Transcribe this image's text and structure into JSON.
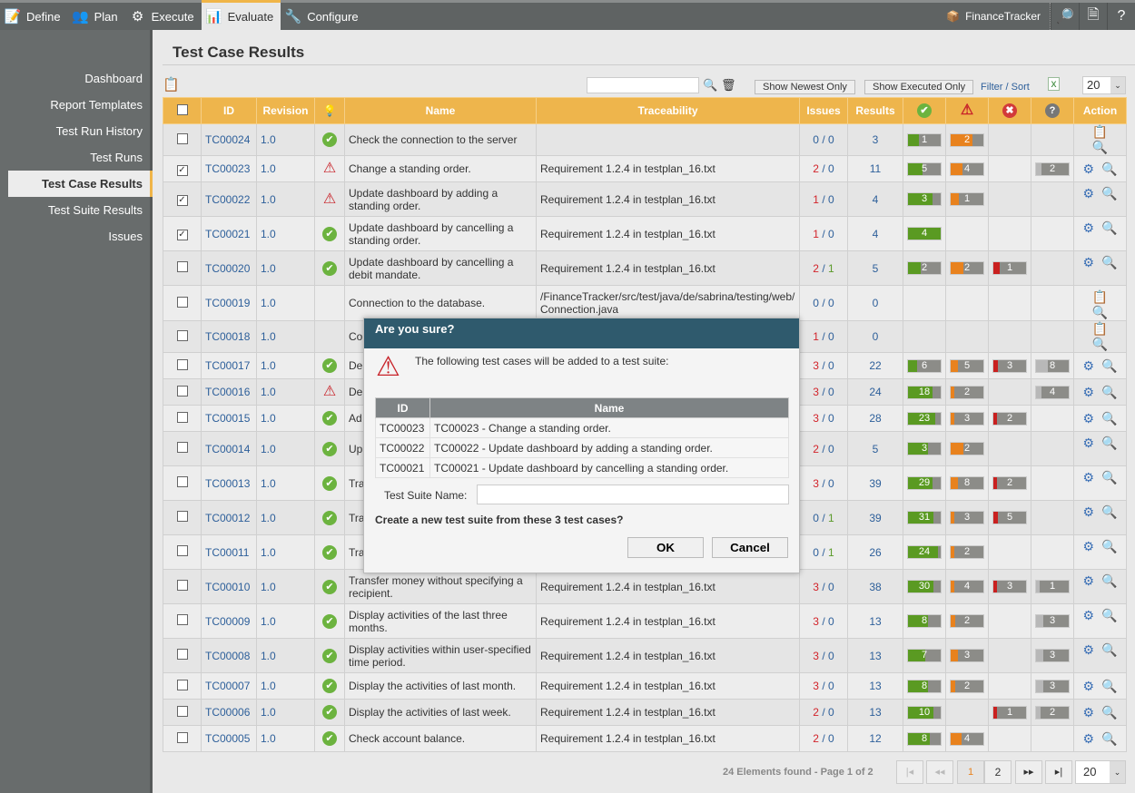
{
  "topnav": [
    {
      "label": "Define",
      "icon": "notepad-icon"
    },
    {
      "label": "Plan",
      "icon": "users-icon"
    },
    {
      "label": "Execute",
      "icon": "gear-icon"
    },
    {
      "label": "Evaluate",
      "icon": "report-icon",
      "active": true
    },
    {
      "label": "Configure",
      "icon": "tools-icon"
    }
  ],
  "project": "FinanceTracker",
  "sidebar": [
    "Dashboard",
    "Report Templates",
    "Test Run History",
    "Test Runs",
    "Test Case Results",
    "Test Suite Results",
    "Issues"
  ],
  "sidebar_active": "Test Case Results",
  "page_title": "Test Case Results",
  "toolbar": {
    "search_value": "",
    "newest": "Show Newest Only",
    "executed": "Show Executed Only",
    "filter": "Filter / Sort",
    "page_size": "20"
  },
  "columns": [
    "ID",
    "Revision",
    "Name",
    "Traceability",
    "Issues",
    "Results",
    "Action"
  ],
  "colors": {
    "pass": "#5a9a22",
    "warn": "#e8821e",
    "fail": "#c9201f",
    "unknown": "#b8b8b8",
    "bar_bg": "#8c8c88",
    "header": "#eeb54c",
    "dialog_header": "#2f5a6d"
  },
  "rows": [
    {
      "checked": false,
      "id": "TC00024",
      "rev": "1.0",
      "status": "ok",
      "name": "Check the connection to the server",
      "trace": "",
      "iss": [
        "0",
        "0"
      ],
      "results": 3,
      "pass": 1,
      "warn": 2,
      "act": "clipboard"
    },
    {
      "checked": true,
      "id": "TC00023",
      "rev": "1.0",
      "status": "warn",
      "name": "Change a standing order.",
      "trace": "Requirement 1.2.4 in testplan_16.txt",
      "iss": [
        "2",
        "0"
      ],
      "results": 11,
      "pass": 5,
      "warn": 4,
      "unk": 2
    },
    {
      "checked": true,
      "id": "TC00022",
      "rev": "1.0",
      "status": "warn",
      "name": "Update dashboard by adding a standing order.",
      "trace": "Requirement 1.2.4 in testplan_16.txt",
      "iss": [
        "1",
        "0"
      ],
      "results": 4,
      "pass": 3,
      "warn": 1
    },
    {
      "checked": true,
      "id": "TC00021",
      "rev": "1.0",
      "status": "ok",
      "name": "Update dashboard by cancelling a standing order.",
      "trace": "Requirement 1.2.4 in testplan_16.txt",
      "iss": [
        "1",
        "0"
      ],
      "results": 4,
      "pass": 4
    },
    {
      "checked": false,
      "id": "TC00020",
      "rev": "1.0",
      "status": "ok",
      "name": "Update dashboard by cancelling a debit mandate.",
      "trace": "Requirement 1.2.4 in testplan_16.txt",
      "iss": [
        "2",
        "1"
      ],
      "results": 5,
      "pass": 2,
      "warn": 2,
      "fail": 1
    },
    {
      "checked": false,
      "id": "TC00019",
      "rev": "1.0",
      "status": "",
      "name": "Connection to the database.",
      "trace": "/FinanceTracker/src/test/java/de/sabrina/testing/web/Connection.java",
      "iss": [
        "0",
        "0"
      ],
      "results": 0,
      "act": "clipboard"
    },
    {
      "checked": false,
      "id": "TC00018",
      "rev": "1.0",
      "status": "",
      "name": "Co",
      "trace": "",
      "iss": [
        "1",
        "0"
      ],
      "results": 0,
      "act": "clipboard"
    },
    {
      "checked": false,
      "id": "TC00017",
      "rev": "1.0",
      "status": "ok",
      "name": "De",
      "trace": "",
      "iss": [
        "3",
        "0"
      ],
      "results": 22,
      "pass": 6,
      "warn": 5,
      "fail": 3,
      "unk": 8
    },
    {
      "checked": false,
      "id": "TC00016",
      "rev": "1.0",
      "status": "warn",
      "name": "De",
      "trace": "",
      "iss": [
        "3",
        "0"
      ],
      "results": 24,
      "pass": 18,
      "warn": 2,
      "unk": 4
    },
    {
      "checked": false,
      "id": "TC00015",
      "rev": "1.0",
      "status": "ok",
      "name": "Ad",
      "trace": "",
      "iss": [
        "3",
        "0"
      ],
      "results": 28,
      "pass": 23,
      "warn": 3,
      "fail": 2
    },
    {
      "checked": false,
      "id": "TC00014",
      "rev": "1.0",
      "status": "ok",
      "name": "Up tra",
      "trace": "",
      "iss": [
        "2",
        "0"
      ],
      "results": 5,
      "pass": 3,
      "warn": 2,
      "tall": true
    },
    {
      "checked": false,
      "id": "TC00013",
      "rev": "1.0",
      "status": "ok",
      "name": "Tra ref",
      "trace": "",
      "iss": [
        "3",
        "0"
      ],
      "results": 39,
      "pass": 29,
      "warn": 8,
      "fail": 2,
      "tall": true
    },
    {
      "checked": false,
      "id": "TC00012",
      "rev": "1.0",
      "status": "ok",
      "name": "Tra an",
      "trace": "",
      "iss": [
        "0",
        "1"
      ],
      "results": 39,
      "pass": 31,
      "warn": 3,
      "fail": 5,
      "tall": true
    },
    {
      "checked": false,
      "id": "TC00011",
      "rev": "1.0",
      "status": "ok",
      "name": "Tra the",
      "trace": "",
      "iss": [
        "0",
        "1"
      ],
      "results": 26,
      "pass": 24,
      "warn": 2,
      "tall": true
    },
    {
      "checked": false,
      "id": "TC00010",
      "rev": "1.0",
      "status": "ok",
      "name": "Transfer money without specifying a recipient.",
      "trace": "Requirement 1.2.4 in testplan_16.txt",
      "iss": [
        "3",
        "0"
      ],
      "results": 38,
      "pass": 30,
      "warn": 4,
      "fail": 3,
      "unk": 1
    },
    {
      "checked": false,
      "id": "TC00009",
      "rev": "1.0",
      "status": "ok",
      "name": "Display activities of the last three months.",
      "trace": "Requirement 1.2.4 in testplan_16.txt",
      "iss": [
        "3",
        "0"
      ],
      "results": 13,
      "pass": 8,
      "warn": 2,
      "unk": 3
    },
    {
      "checked": false,
      "id": "TC00008",
      "rev": "1.0",
      "status": "ok",
      "name": "Display activities within user-specified time period.",
      "trace": "Requirement 1.2.4 in testplan_16.txt",
      "iss": [
        "3",
        "0"
      ],
      "results": 13,
      "pass": 7,
      "warn": 3,
      "unk": 3
    },
    {
      "checked": false,
      "id": "TC00007",
      "rev": "1.0",
      "status": "ok",
      "name": "Display the activities of last month.",
      "trace": "Requirement 1.2.4 in testplan_16.txt",
      "iss": [
        "3",
        "0"
      ],
      "results": 13,
      "pass": 8,
      "warn": 2,
      "unk": 3
    },
    {
      "checked": false,
      "id": "TC00006",
      "rev": "1.0",
      "status": "ok",
      "name": "Display the activities of last week.",
      "trace": "Requirement 1.2.4 in testplan_16.txt",
      "iss": [
        "2",
        "0"
      ],
      "results": 13,
      "pass": 10,
      "fail": 1,
      "unk": 2
    },
    {
      "checked": false,
      "id": "TC00005",
      "rev": "1.0",
      "status": "ok",
      "name": "Check account balance.",
      "trace": "Requirement 1.2.4 in testplan_16.txt",
      "iss": [
        "2",
        "0"
      ],
      "results": 12,
      "pass": 8,
      "warn": 4
    }
  ],
  "dialog": {
    "title": "Are you sure?",
    "message": "The following test cases will be added to a test suite:",
    "cols": [
      "ID",
      "Name"
    ],
    "items": [
      [
        "TC00023",
        "TC00023 - Change a standing order."
      ],
      [
        "TC00022",
        "TC00022 - Update dashboard by adding a standing order."
      ],
      [
        "TC00021",
        "TC00021 - Update dashboard by cancelling a standing order."
      ]
    ],
    "suite_label": "Test Suite Name:",
    "suite_value": "",
    "question": "Create a new test suite from these 3 test cases?",
    "ok": "OK",
    "cancel": "Cancel"
  },
  "pager": {
    "summary": "24 Elements found - Page 1 of 2",
    "pages": [
      "1",
      "2"
    ],
    "current": "1",
    "first": "|◂",
    "prev": "◂◂",
    "next": "▸▸",
    "last": "▸|",
    "page_size": "20"
  }
}
